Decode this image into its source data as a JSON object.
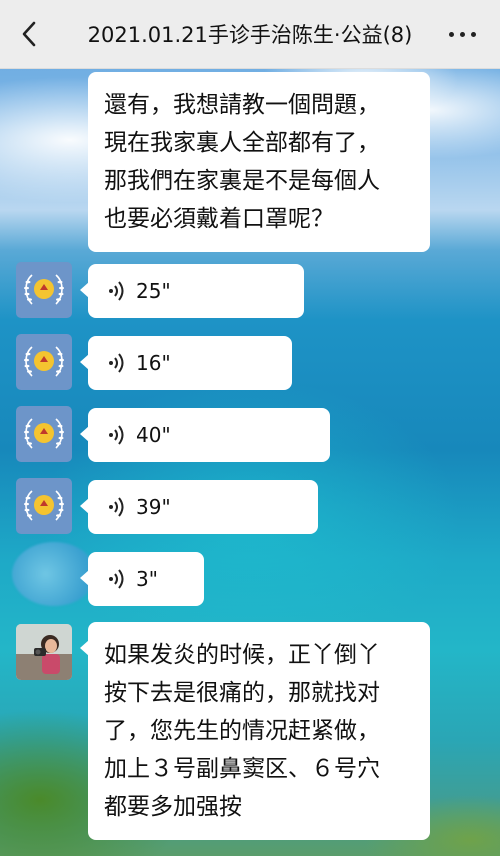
{
  "header": {
    "title": "2021.01.21手诊手治陈生·公益(8)",
    "back_icon": "back-arrow-icon",
    "more_icon": "more-dots-icon"
  },
  "messages": [
    {
      "type": "text",
      "lines": [
        "還有，我想請教一個問題，",
        "現在我家裏人全部都有了，",
        "那我們在家裏是不是每個人",
        "也要必須戴着口罩呢？"
      ]
    },
    {
      "type": "voice",
      "duration": "25\""
    },
    {
      "type": "voice",
      "duration": "16\""
    },
    {
      "type": "voice",
      "duration": "40\""
    },
    {
      "type": "voice",
      "duration": "39\""
    },
    {
      "type": "voice",
      "duration": "3\""
    },
    {
      "type": "text",
      "lines": [
        "如果发炎的时候，正丫倒丫",
        "按下去是很痛的，那就找对",
        "了，您先生的情况赶紧做，",
        "加上３号副鼻窦区、６号穴",
        "都要多加强按"
      ]
    }
  ],
  "colors": {
    "header_bg": "#ededed",
    "bubble_bg": "#ffffff",
    "emblem_bg": "#6d95c9"
  }
}
